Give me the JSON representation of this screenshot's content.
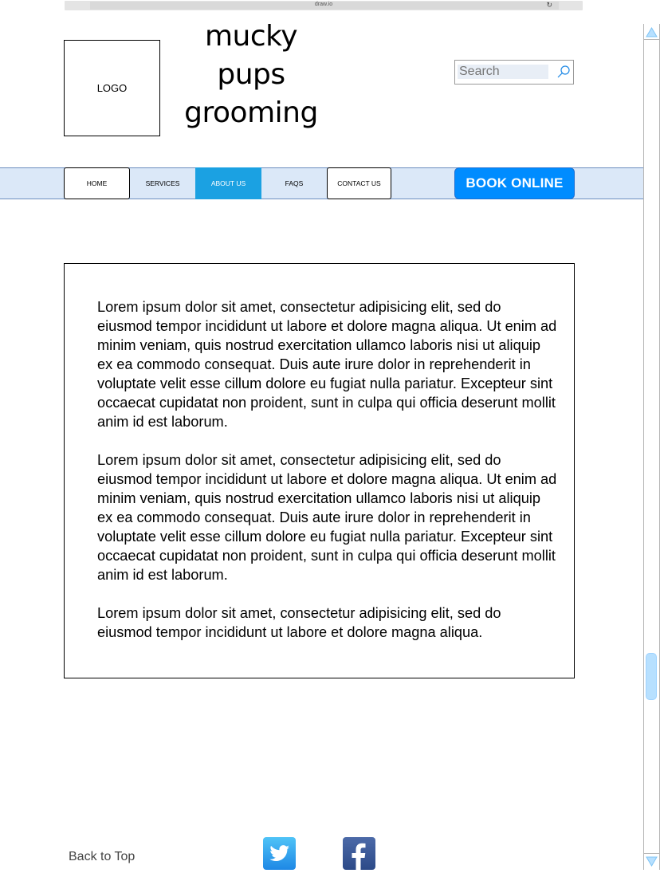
{
  "browser": {
    "url": "draw.io"
  },
  "header": {
    "logo_label": "LOGO",
    "brand_lines": [
      "mucky",
      "pups",
      "grooming"
    ],
    "search_placeholder": "Search"
  },
  "nav": {
    "items": [
      {
        "label": "HOME"
      },
      {
        "label": "SERVICES"
      },
      {
        "label": "ABOUT US",
        "active": true
      },
      {
        "label": "FAQS"
      },
      {
        "label": "CONTACT US"
      }
    ],
    "book_label": "BOOK ONLINE"
  },
  "content": {
    "paragraphs": [
      "Lorem ipsum dolor sit amet, consectetur adipisicing elit, sed do eiusmod tempor incididunt ut labore et dolore magna aliqua. Ut enim ad minim veniam, quis nostrud exercitation ullamco laboris nisi ut aliquip ex ea commodo consequat. Duis aute irure dolor in reprehenderit in voluptate velit esse cillum dolore eu fugiat nulla pariatur. Excepteur sint occaecat cupidatat non proident, sunt in culpa qui officia deserunt mollit anim id est laborum.",
      "Lorem ipsum dolor sit amet, consectetur adipisicing elit, sed do eiusmod tempor incididunt ut labore et dolore magna aliqua. Ut enim ad minim veniam, quis nostrud exercitation ullamco laboris nisi ut aliquip ex ea commodo consequat. Duis aute irure dolor in reprehenderit in voluptate velit esse cillum dolore eu fugiat nulla pariatur. Excepteur sint occaecat cupidatat non proident, sunt in culpa qui officia deserunt mollit anim id est laborum.",
      "Lorem ipsum dolor sit amet, consectetur adipisicing elit, sed do eiusmod tempor incididunt ut labore et dolore magna aliqua."
    ]
  },
  "footer": {
    "back_to_top": "Back to Top",
    "social": [
      "twitter-icon",
      "facebook-icon"
    ]
  },
  "colors": {
    "nav_band": "#dbe8f8",
    "active_tab": "#1ba1e2",
    "book_button": "#008cff",
    "scroll_thumb": "#b7e0ff"
  }
}
